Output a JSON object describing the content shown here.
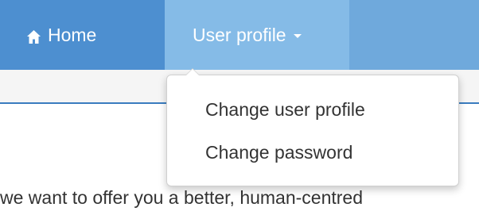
{
  "navbar": {
    "home_label": "Home",
    "home_icon": "home-icon",
    "user_profile_label": "User profile",
    "caret_icon": "caret-down-icon"
  },
  "dropdown": {
    "items": [
      {
        "label": "Change user profile"
      },
      {
        "label": "Change password"
      }
    ]
  },
  "content": {
    "partial_text": "we want to offer you a better, human-centred"
  },
  "colors": {
    "nav_home_bg": "#4d8fd0",
    "nav_bg": "#6fa9dc",
    "nav_active_bg": "#85bbe7",
    "subbar_border": "#3a7cbf"
  }
}
